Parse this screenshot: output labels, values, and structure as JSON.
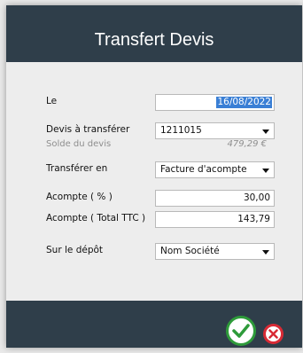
{
  "dialog": {
    "title": "Transfert Devis",
    "fields": {
      "date": {
        "label": "Le",
        "value": "16/08/2022"
      },
      "devis": {
        "label": "Devis à transférer",
        "value": "1211015"
      },
      "solde": {
        "label": "Solde du devis",
        "value": "479,29 €"
      },
      "transferer_en": {
        "label": "Transférer en",
        "value": "Facture d'acompte"
      },
      "acompte_pct": {
        "label": "Acompte ( % )",
        "value": "30,00"
      },
      "acompte_ttc": {
        "label": "Acompte ( Total TTC )",
        "value": "143,79"
      },
      "depot": {
        "label": "Sur le dépôt",
        "value": "Nom Société"
      }
    }
  },
  "colors": {
    "header": "#2f3e4a",
    "ok": "#2e9b3a",
    "cancel": "#d82a35",
    "selection": "#3a7fd5"
  },
  "icons": {
    "ok": "checkmark-icon",
    "cancel": "close-icon"
  }
}
